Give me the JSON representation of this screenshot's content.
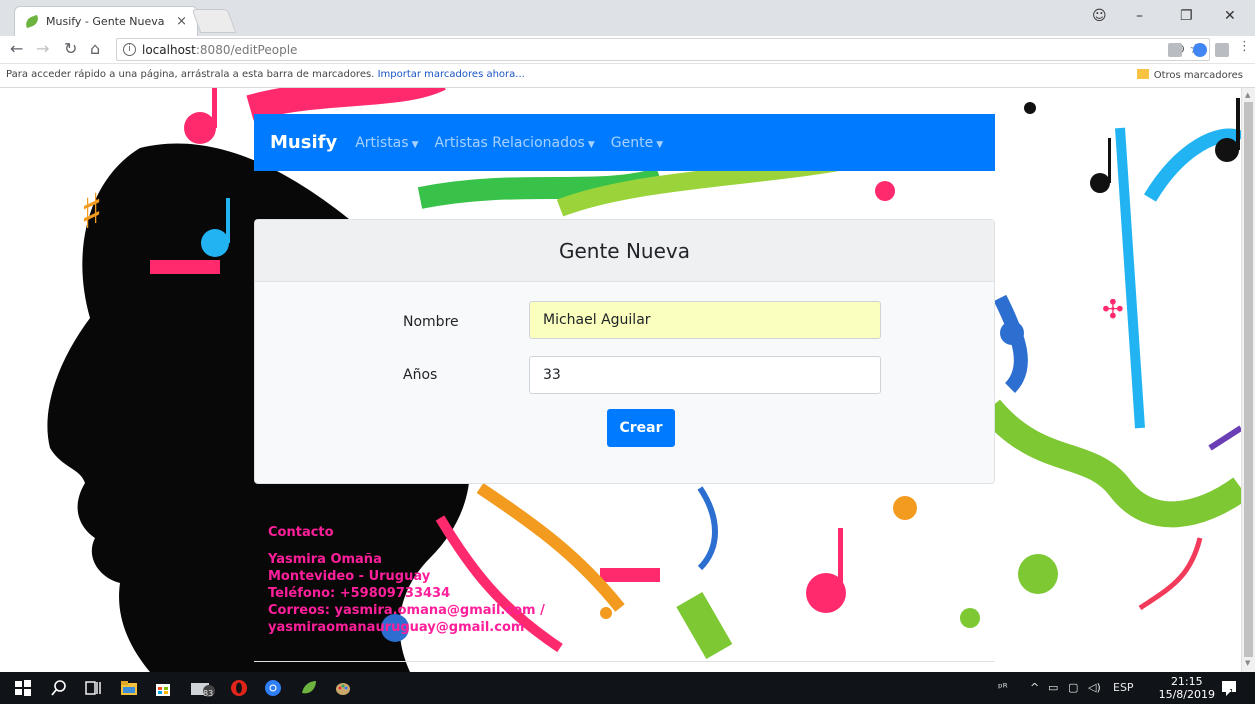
{
  "browser": {
    "tab_title": "Musify - Gente Nueva",
    "tab_close": "×",
    "url_host": "localhost",
    "url_path": ":8080/editPeople",
    "bookmarks_hint": "Para acceder rápido a una página, arrástrala a esta barra de marcadores.",
    "bookmarks_link": "Importar marcadores ahora...",
    "other_bookmarks": "Otros marcadores"
  },
  "navbar": {
    "brand": "Musify",
    "items": [
      {
        "label": "Artistas"
      },
      {
        "label": "Artistas Relacionados"
      },
      {
        "label": "Gente"
      }
    ]
  },
  "form": {
    "title": "Gente Nueva",
    "name_label": "Nombre",
    "name_value": "Michael Aguilar",
    "age_label": "Años",
    "age_value": "33",
    "submit_label": "Crear"
  },
  "contact": {
    "heading": "Contacto",
    "name": "Yasmira Omaña",
    "location": "Montevideo - Uruguay",
    "phone": "Teléfono: +59809733434",
    "emails": "Correos: yasmira.omana@gmail.com /",
    "email2": "yasmiraomanauruguay@gmail.com"
  },
  "taskbar": {
    "badge": "83",
    "language": "ESP",
    "time": "21:15",
    "date": "15/8/2019",
    "notification_count": "1"
  },
  "colors": {
    "primary": "#007bff",
    "contact_text": "#ff1f9b",
    "autofill": "#faffbd"
  }
}
